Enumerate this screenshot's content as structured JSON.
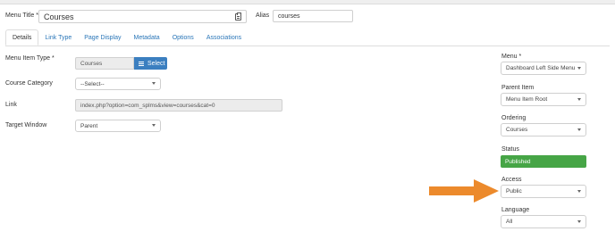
{
  "header": {
    "menu_title_label": "Menu Title *",
    "menu_title_value": "Courses",
    "alias_label": "Alias",
    "alias_value": "courses"
  },
  "tabs": [
    {
      "label": "Details",
      "active": true
    },
    {
      "label": "Link Type",
      "active": false
    },
    {
      "label": "Page Display",
      "active": false
    },
    {
      "label": "Metadata",
      "active": false
    },
    {
      "label": "Options",
      "active": false
    },
    {
      "label": "Associations",
      "active": false
    }
  ],
  "details": {
    "menu_item_type_label": "Menu Item Type *",
    "menu_item_type_value": "Courses",
    "select_button_label": "Select",
    "course_category_label": "Course Category",
    "course_category_value": "--Select--",
    "link_label": "Link",
    "link_value": "index.php?option=com_splms&view=courses&cat=0",
    "target_window_label": "Target Window",
    "target_window_value": "Parent"
  },
  "sidebar": {
    "menu_label": "Menu *",
    "menu_value": "Dashboard Left Side Menu",
    "parent_item_label": "Parent Item",
    "parent_item_value": "Menu Item Root",
    "ordering_label": "Ordering",
    "ordering_value": "Courses",
    "status_label": "Status",
    "status_value": "Published",
    "access_label": "Access",
    "access_value": "Public",
    "language_label": "Language",
    "language_value": "All"
  },
  "colors": {
    "link_blue": "#2a76b8",
    "button_blue": "#3b7fc0",
    "published_green": "#46a546",
    "arrow_orange": "#ec8a2c"
  },
  "icons": {
    "title_field_icon": "clipboard-icon",
    "select_button_icon": "list-icon",
    "annotation": "arrow-right-icon"
  }
}
